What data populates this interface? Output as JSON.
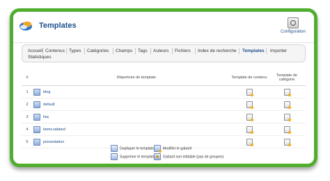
{
  "header": {
    "title": "Templates",
    "config_label": "Configuration"
  },
  "tabs": [
    {
      "label": "Accueil"
    },
    {
      "label": "Contenus"
    },
    {
      "label": "Types"
    },
    {
      "label": "Catégories"
    },
    {
      "label": "Champs"
    },
    {
      "label": "Tags"
    },
    {
      "label": "Auteurs"
    },
    {
      "label": "Fichiers"
    },
    {
      "label": "Index de recherche"
    },
    {
      "label": "Templates"
    },
    {
      "label": "Importer"
    },
    {
      "label": "Statistiques"
    }
  ],
  "active_tab": "Templates",
  "table": {
    "headers": {
      "num": "#",
      "dir": "Répertoire de template",
      "content": "Template de contenu",
      "category": "Template de catégorie"
    },
    "rows": [
      {
        "num": "1",
        "name": "blog"
      },
      {
        "num": "2",
        "name": "default"
      },
      {
        "num": "3",
        "name": "faq"
      },
      {
        "num": "4",
        "name": "items-tabbed"
      },
      {
        "num": "5",
        "name": "presentation"
      }
    ]
  },
  "legend": {
    "duplicate": "Dupliquer le template",
    "edit": "Modifier le gabarit",
    "delete": "Supprimer le template",
    "locked": "Gabarit non éditable (pas de groupes)"
  }
}
